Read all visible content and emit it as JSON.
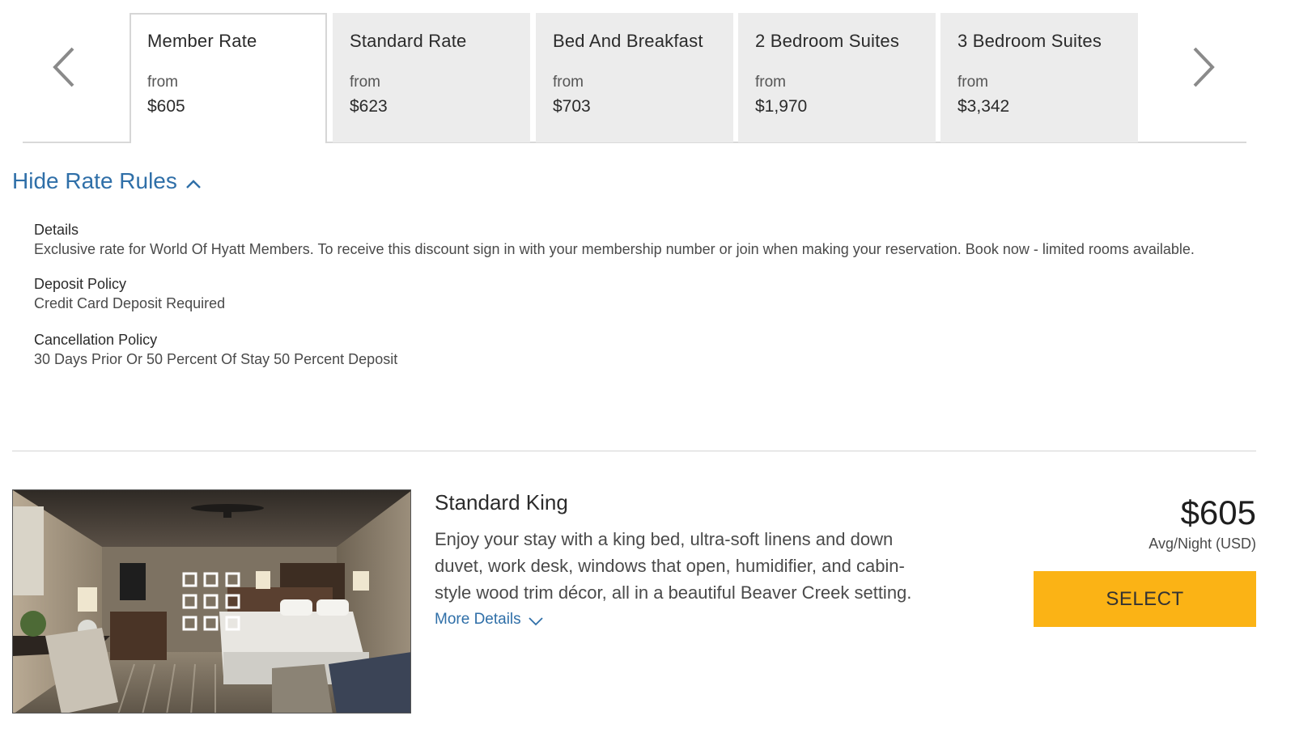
{
  "rate_tabs": {
    "items": [
      {
        "name": "Member Rate",
        "from_label": "from",
        "price": "$605",
        "active": true
      },
      {
        "name": "Standard Rate",
        "from_label": "from",
        "price": "$623",
        "active": false
      },
      {
        "name": "Bed And Breakfast",
        "from_label": "from",
        "price": "$703",
        "active": false
      },
      {
        "name": "2 Bedroom Suites",
        "from_label": "from",
        "price": "$1,970",
        "active": false
      },
      {
        "name": "3 Bedroom Suites",
        "from_label": "from",
        "price": "$3,342",
        "active": false
      }
    ],
    "prev_icon": "chevron-left-icon",
    "next_icon": "chevron-right-icon"
  },
  "rate_rules": {
    "toggle_label": "Hide Rate Rules",
    "toggle_icon": "chevron-up-icon",
    "details_title": "Details",
    "details_text": "Exclusive rate for World Of Hyatt Members. To receive this discount sign in with your membership number or join when making your reservation. Book now - limited rooms available.",
    "deposit_title": "Deposit Policy",
    "deposit_text": "Credit Card Deposit Required",
    "cancellation_title": "Cancellation Policy",
    "cancellation_text": "30 Days Prior Or 50 Percent Of Stay 50 Percent Deposit"
  },
  "room": {
    "name": "Standard King",
    "description": "Enjoy your stay with a king bed, ultra-soft linens and down duvet, work desk, windows that open, humidifier, and cabin-style wood trim décor, all in a beautiful Beaver Creek setting.",
    "more_details_label": "More Details",
    "more_details_icon": "chevron-down-icon",
    "gallery_icon": "gallery-grid-icon",
    "price": "$605",
    "price_unit": "Avg/Night (USD)",
    "select_label": "SELECT"
  },
  "colors": {
    "link_blue": "#2f6fa8",
    "select_yellow": "#fbb315",
    "tab_inactive_bg": "#ececec"
  }
}
